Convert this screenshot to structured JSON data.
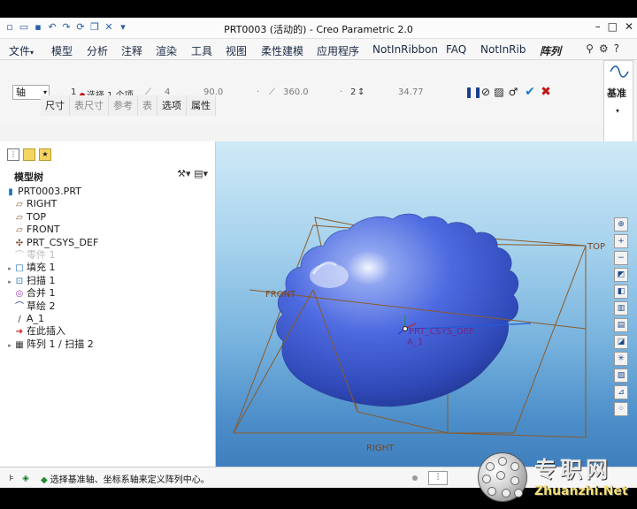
{
  "window": {
    "title": "PRT0003 (活动的) - Creo Parametric 2.0",
    "quick_access_icons": [
      "new-icon",
      "open-icon",
      "save-icon",
      "undo-icon",
      "redo-icon",
      "regenerate-icon",
      "windows-icon",
      "close-window-icon",
      "customize-icon"
    ]
  },
  "menu": {
    "items": [
      "文件",
      "模型",
      "分析",
      "注释",
      "渲染",
      "工具",
      "视图",
      "柔性建模",
      "应用程序",
      "NotInRibbon",
      "FAQ",
      "NotInRib",
      "阵列"
    ],
    "file_caret": "▾"
  },
  "dashboard": {
    "pattern_type": "轴",
    "first_direction_count": "1",
    "selection_label": "选择 1 个项",
    "member_count": "4",
    "increment_angle": "90.0",
    "total_angle": "360.0",
    "second_direction_count": "2",
    "radial_spacing": "34.77"
  },
  "sub_tabs": [
    "尺寸",
    "表尺寸",
    "参考",
    "表",
    "选项",
    "属性"
  ],
  "datum_panel": {
    "label": "基准"
  },
  "model_tree": {
    "title": "模型树",
    "root": "PRT0003.PRT",
    "items": [
      {
        "label": "RIGHT",
        "icon": "datum-plane-icon",
        "expand": ""
      },
      {
        "label": "TOP",
        "icon": "datum-plane-icon",
        "expand": ""
      },
      {
        "label": "FRONT",
        "icon": "datum-plane-icon",
        "expand": ""
      },
      {
        "label": "PRT_CSYS_DEF",
        "icon": "csys-icon",
        "expand": ""
      },
      {
        "label": "零件 1",
        "icon": "hidden-feature-icon",
        "expand": "",
        "ghost": true
      },
      {
        "label": "填充 1",
        "icon": "fill-icon",
        "expand": "▸"
      },
      {
        "label": "扫描 1",
        "icon": "sweep-icon",
        "expand": "▸"
      },
      {
        "label": "合并 1",
        "icon": "merge-icon",
        "expand": ""
      },
      {
        "label": "草绘 2",
        "icon": "sketch-icon",
        "expand": ""
      },
      {
        "label": "A_1",
        "icon": "axis-icon",
        "expand": ""
      },
      {
        "label": "在此插入",
        "icon": "insert-here-icon",
        "expand": ""
      },
      {
        "label": "阵列 1 / 扫描 2",
        "icon": "pattern-icon",
        "expand": "▸"
      }
    ]
  },
  "viewport": {
    "labels": {
      "top": "TOP",
      "front": "FRONT",
      "right": "RIGHT",
      "csys": "PRT_CSYS_DEF",
      "axis": "A_1"
    }
  },
  "status": {
    "message": "选择基准轴、坐标系轴来定义阵列中心。",
    "filter_icon": "filter-icon"
  },
  "watermark": {
    "chinese": "专职网",
    "url": "Zhuanzhi.Net"
  }
}
